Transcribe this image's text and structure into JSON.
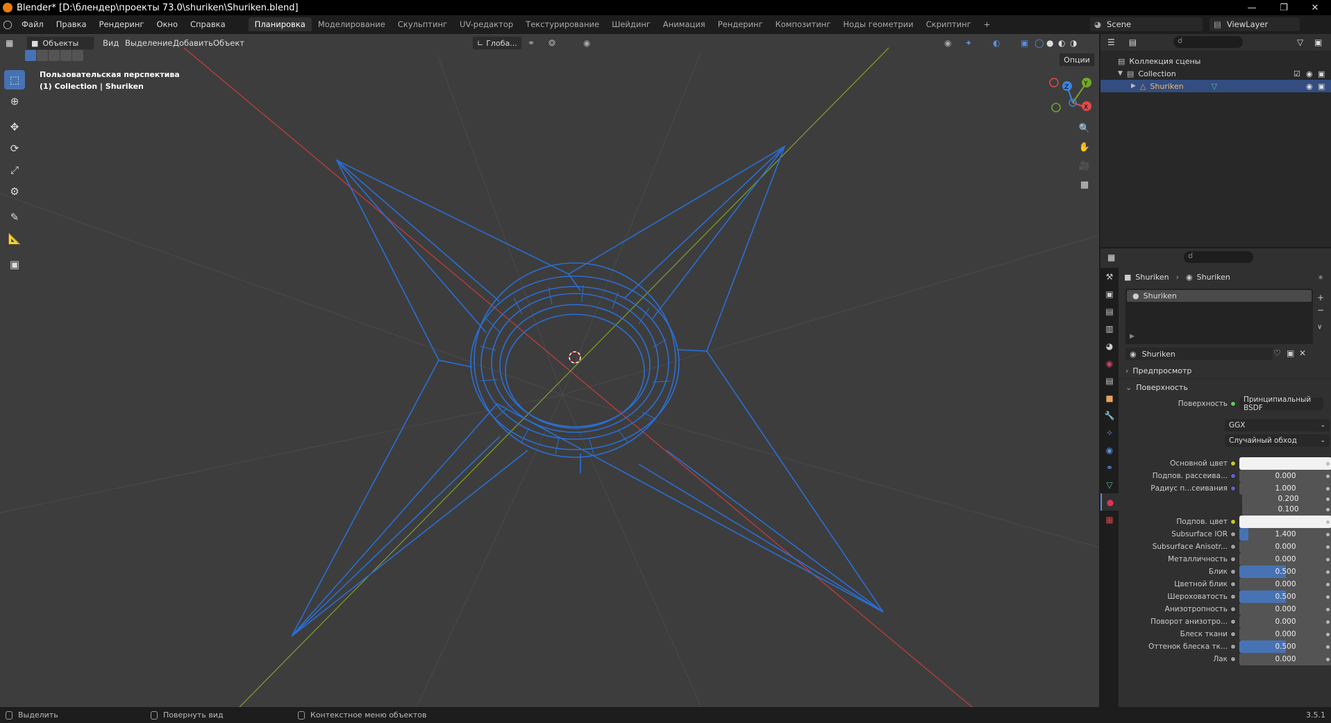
{
  "window": {
    "title": "Blender* [D:\\блендер\\проекты 73.0\\shuriken\\Shuriken.blend]"
  },
  "menu": [
    "Файл",
    "Правка",
    "Рендеринг",
    "Окно",
    "Справка"
  ],
  "workspaces": [
    "Планировка",
    "Моделирование",
    "Скульптинг",
    "UV-редактор",
    "Текстурирование",
    "Шейдинг",
    "Анимация",
    "Рендеринг",
    "Композитинг",
    "Ноды геометрии",
    "Скриптинг"
  ],
  "active_workspace": "Планировка",
  "scene": {
    "name": "Scene",
    "view_layer": "ViewLayer"
  },
  "viewport": {
    "mode": "Объекты",
    "menu": [
      "Вид",
      "Выделение",
      "Добавить",
      "Объект"
    ],
    "orientation": "Глоба...",
    "options": "Опции",
    "info_line1": "Пользовательская перспектива",
    "info_line2": "(1) Collection | Shuriken"
  },
  "gizmo": {
    "x": "X",
    "y": "Y",
    "z": "Z"
  },
  "outliner": {
    "root": "Коллекция сцены",
    "collection": "Collection",
    "object": "Shuriken"
  },
  "properties": {
    "breadcrumb_object": "Shuriken",
    "breadcrumb_material": "Shuriken",
    "slot": "Shuriken",
    "material_name": "Shuriken",
    "panel_preview": "Предпросмотр",
    "panel_surface": "Поверхность",
    "surface_label": "Поверхность",
    "surface_value": "Принципиальный BSDF",
    "distribution": "GGX",
    "subsurface_method": "Случайный обход",
    "rows": [
      {
        "label": "Основной цвет",
        "type": "color",
        "value": ""
      },
      {
        "label": "Подпов. рассеива...",
        "type": "num",
        "value": "0.000",
        "fill": 0,
        "dot": "blue"
      },
      {
        "label": "Радиус п...сеивания",
        "type": "num",
        "value": "1.000",
        "fill": 0,
        "dot": "blue"
      },
      {
        "label": "",
        "type": "num",
        "value": "0.200",
        "fill": 0,
        "dot": "none"
      },
      {
        "label": "",
        "type": "num",
        "value": "0.100",
        "fill": 0,
        "dot": "none"
      },
      {
        "label": "Подпов. цвет",
        "type": "color",
        "value": ""
      },
      {
        "label": "Subsurface IOR",
        "type": "num",
        "value": "1.400",
        "fill": 0.1,
        "dot": "gray"
      },
      {
        "label": "Subsurface Anisotr...",
        "type": "num",
        "value": "0.000",
        "fill": 0,
        "dot": "gray"
      },
      {
        "label": "Металличность",
        "type": "num",
        "value": "0.000",
        "fill": 0,
        "dot": "gray"
      },
      {
        "label": "Блик",
        "type": "num",
        "value": "0.500",
        "fill": 0.5,
        "dot": "gray"
      },
      {
        "label": "Цветной блик",
        "type": "num",
        "value": "0.000",
        "fill": 0,
        "dot": "gray"
      },
      {
        "label": "Шероховатость",
        "type": "num",
        "value": "0.500",
        "fill": 0.5,
        "dot": "gray"
      },
      {
        "label": "Анизотропность",
        "type": "num",
        "value": "0.000",
        "fill": 0,
        "dot": "gray"
      },
      {
        "label": "Поворот анизотро...",
        "type": "num",
        "value": "0.000",
        "fill": 0,
        "dot": "gray"
      },
      {
        "label": "Блеск ткани",
        "type": "num",
        "value": "0.000",
        "fill": 0,
        "dot": "gray"
      },
      {
        "label": "Оттенок блеска тк...",
        "type": "num",
        "value": "0.500",
        "fill": 0.5,
        "dot": "gray"
      },
      {
        "label": "Лак",
        "type": "num",
        "value": "0.000",
        "fill": 0,
        "dot": "gray"
      }
    ]
  },
  "status": {
    "select": "Выделить",
    "rotate": "Повернуть вид",
    "context": "Контекстное меню объектов",
    "version": "3.5.1"
  }
}
